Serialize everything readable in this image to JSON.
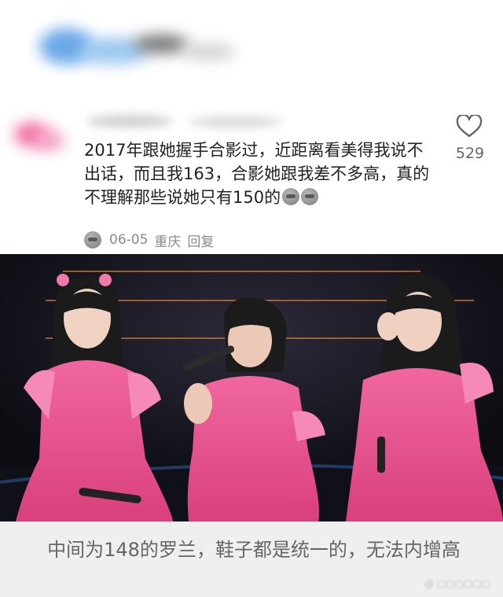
{
  "comment": {
    "text": "2017年跟她握手合影过，近距离看美得我说不出话，而且我163，合影她跟我差不多高，真的不理解那些说她只有150的",
    "date": "06-05",
    "location": "重庆",
    "reply_label": "回复",
    "like_count": "529",
    "like_icon": "heart-outline-icon",
    "emoji_icon": "sweat-face-emoji"
  },
  "photo": {
    "description_colors": {
      "dress": "#e8508a",
      "stage": "#14141c"
    }
  },
  "caption": {
    "text": "中间为148的罗兰，鞋子都是统一的，无法内增高"
  },
  "colors": {
    "text": "#222222",
    "meta": "#8a8a8a",
    "caption_bg": "#efefef"
  }
}
